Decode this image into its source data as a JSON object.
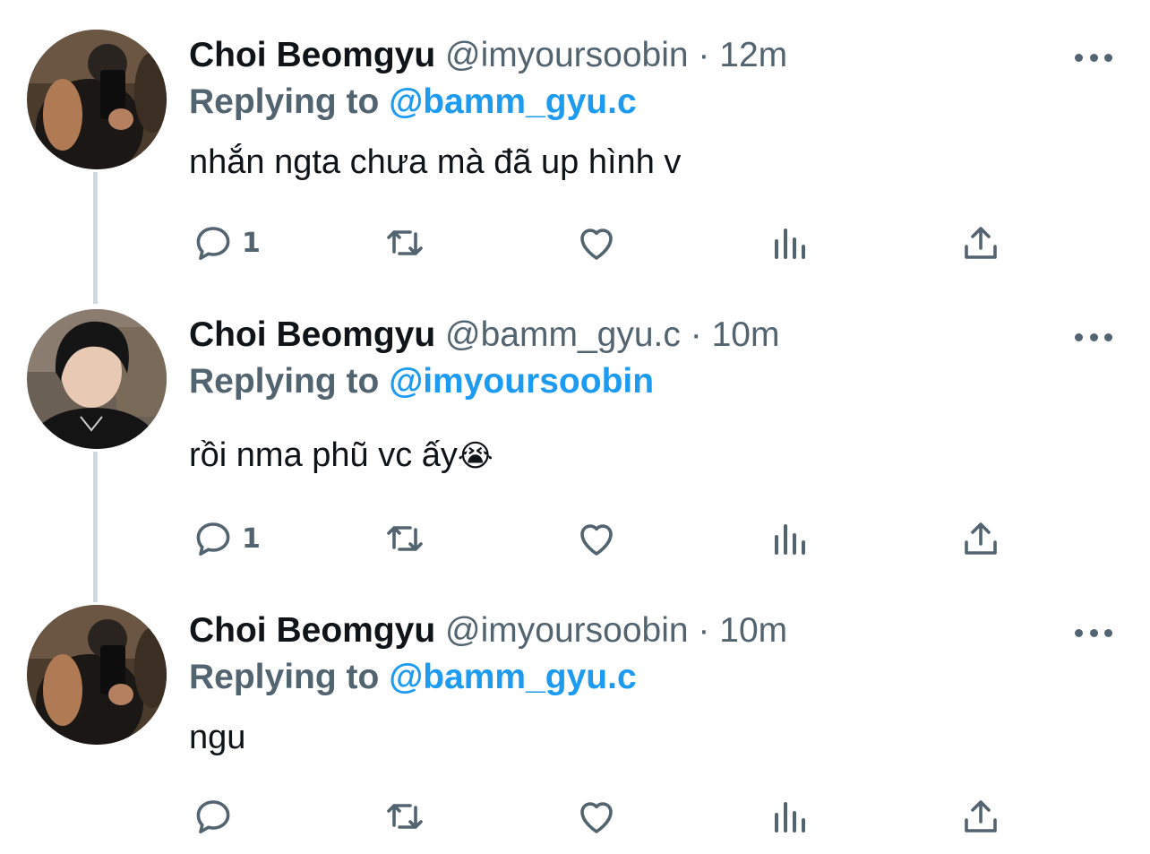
{
  "tweets": [
    {
      "display_name": "Choi Beomgyu",
      "handle": "@imyoursoobin",
      "separator": "·",
      "time": "12m",
      "replying_prefix": "Replying to",
      "replying_to": "@bamm_gyu.c",
      "text": "nhắn ngta chưa mà đã up hình v",
      "emoji": "",
      "reply_count": "1",
      "avatar": "mirror-selfie"
    },
    {
      "display_name": "Choi Beomgyu",
      "handle": "@bamm_gyu.c",
      "separator": "·",
      "time": "10m",
      "replying_prefix": "Replying to",
      "replying_to": "@imyoursoobin",
      "text": "rồi nma phũ vc ấy",
      "emoji": "😭",
      "reply_count": "1",
      "avatar": "dark-hair-portrait"
    },
    {
      "display_name": "Choi Beomgyu",
      "handle": "@imyoursoobin",
      "separator": "·",
      "time": "10m",
      "replying_prefix": "Replying to",
      "replying_to": "@bamm_gyu.c",
      "text": "ngu",
      "emoji": "",
      "reply_count": "",
      "avatar": "mirror-selfie"
    }
  ],
  "icons": {
    "reply": "reply-icon",
    "retweet": "retweet-icon",
    "like": "heart-icon",
    "analytics": "analytics-icon",
    "share": "share-icon",
    "more": "more-icon"
  },
  "colors": {
    "text": "#0f1419",
    "secondary": "#536471",
    "accent": "#1d9bf0",
    "thread_line": "#cfd9de"
  }
}
